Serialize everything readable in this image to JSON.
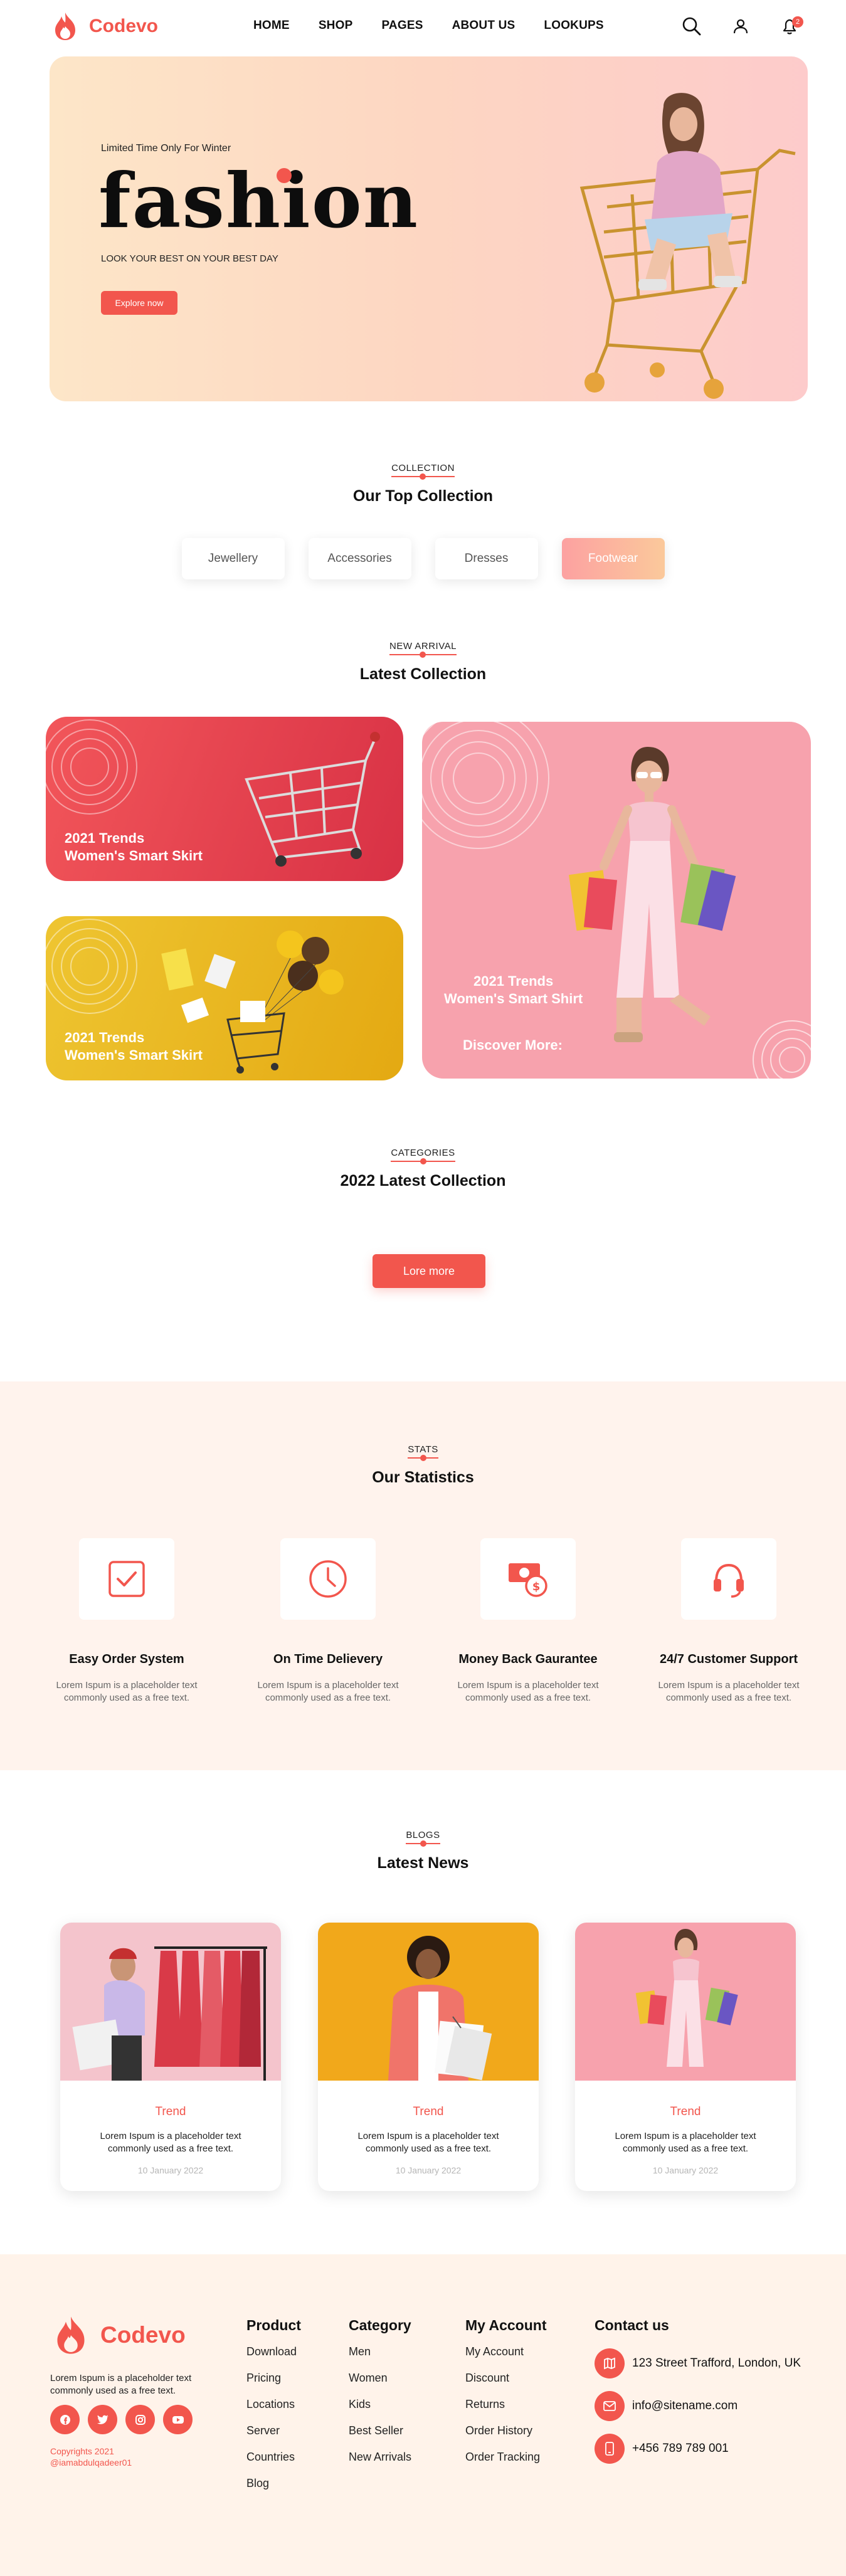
{
  "brand": {
    "name": "Codevo",
    "color": "#f2564d"
  },
  "nav": {
    "items": [
      "HOME",
      "SHOP",
      "PAGES",
      "ABOUT US",
      "LOOKUPS"
    ],
    "cart_count": "2"
  },
  "hero": {
    "tag": "Limited Time Only For Winter",
    "title": "fashion",
    "subtitle": "LOOK YOUR BEST ON YOUR BEST DAY",
    "button": "Explore now"
  },
  "collection": {
    "eyebrow": "COLLECTION",
    "heading": "Our Top Collection",
    "tabs": [
      "Jewellery",
      "Accessories",
      "Dresses",
      "Footwear"
    ],
    "active_tab": "Footwear"
  },
  "latest": {
    "eyebrow": "NEW ARRIVAL",
    "heading": "Latest Collection",
    "card1": {
      "line1": "2021 Trends",
      "line2": "Women's Smart Skirt"
    },
    "card2": {
      "line1": "2021 Trends",
      "line2": "Women's Smart Skirt"
    },
    "card3": {
      "line1": "2021 Trends",
      "line2": "Women's Smart Shirt",
      "cta": "Discover More:"
    }
  },
  "categories": {
    "eyebrow": "CATEGORIES",
    "heading": "2022 Latest Collection",
    "button": "Lore more"
  },
  "stats": {
    "eyebrow": "STATS",
    "heading": "Our Statistics",
    "items": [
      {
        "title": "Easy Order System",
        "icon": "checkbox-icon",
        "desc1": "Lorem Ispum is a placeholder text",
        "desc2": "commonly used as a free text."
      },
      {
        "title": "On Time Delievery",
        "icon": "clock-icon",
        "desc1": "Lorem Ispum is a placeholder text",
        "desc2": "commonly used as a free text."
      },
      {
        "title": "Money Back Gaurantee",
        "icon": "money-icon",
        "desc1": "Lorem Ispum is a placeholder text",
        "desc2": "commonly used as a free text."
      },
      {
        "title": "24/7 Customer Support",
        "icon": "headset-icon",
        "desc1": "Lorem Ispum is a placeholder text",
        "desc2": "commonly used as a free text."
      }
    ]
  },
  "blogs": {
    "eyebrow": "BLOGS",
    "heading": "Latest News",
    "items": [
      {
        "title": "Trend",
        "desc1": "Lorem Ispum is a placeholder text",
        "desc2": "commonly used as a free text.",
        "date": "10 January 2022"
      },
      {
        "title": "Trend",
        "desc1": "Lorem Ispum is a placeholder text",
        "desc2": "commonly used as a free text.",
        "date": "10 January 2022"
      },
      {
        "title": "Trend",
        "desc1": "Lorem Ispum is a placeholder text",
        "desc2": "commonly used as a free text.",
        "date": "10 January 2022"
      }
    ]
  },
  "footer": {
    "about1": "Lorem Ispum is a placeholder text",
    "about2": "commonly used as a free text.",
    "copy1": "Copyrights 2021",
    "copy2": "@iamabdulqadeer01",
    "product": {
      "title": "Product",
      "links": [
        "Download",
        "Pricing",
        "Locations",
        "Server",
        "Countries",
        "Blog"
      ]
    },
    "category": {
      "title": "Category",
      "links": [
        "Men",
        "Women",
        "Kids",
        "Best Seller",
        "New Arrivals"
      ]
    },
    "account": {
      "title": "My Account",
      "links": [
        "My Account",
        "Discount",
        "Returns",
        "Order History",
        "Order Tracking"
      ]
    },
    "contact": {
      "title": "Contact us",
      "address": "123 Street Trafford, London, UK",
      "email": "info@sitename.com",
      "phone": "+456 789 789 001"
    }
  }
}
